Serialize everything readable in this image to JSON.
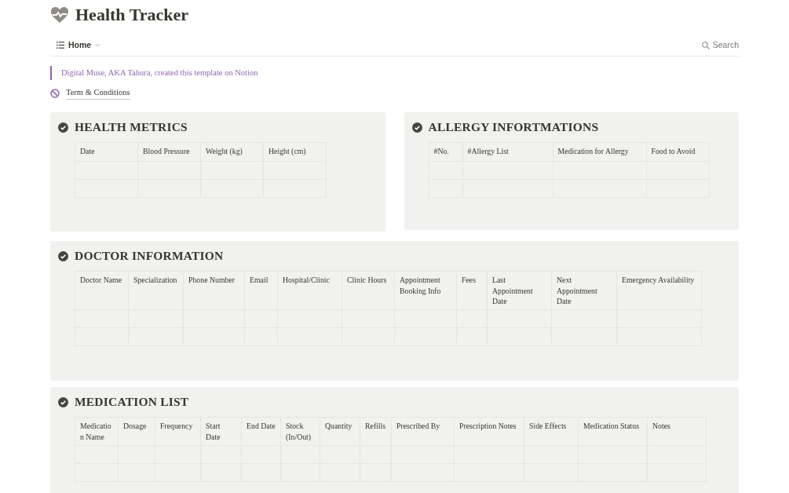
{
  "page": {
    "title": "Health Tracker"
  },
  "nav": {
    "view": "Home",
    "search": "Search"
  },
  "callout": "Digital Muse, AKA Tahura, created this template on Notion",
  "link": "Term & Conditions",
  "sections": [
    {
      "title": "HEALTH METRICS",
      "columns": [
        "Date",
        "Blood Pressure",
        "Weight (kg)",
        "Height (cm)"
      ]
    },
    {
      "title": "ALLERGY INFORTMATIONS",
      "columns": [
        "#No.",
        "#Allergy List",
        "Medication for Allergy",
        "Food to Avoid"
      ]
    },
    {
      "title": "DOCTOR INFORMATION",
      "columns": [
        "Doctor Name",
        "Specialization",
        "Phone Number",
        "Email",
        "Hospital/Clinic",
        "Clinic Hours",
        "Appointment Booking Info",
        "Fees",
        "Last Appointment Date",
        "Next Appointment Date",
        "Emergency Availability"
      ]
    },
    {
      "title": "MEDICATION LIST",
      "columns": [
        "Medication Name",
        "Dosage",
        "Frequency",
        "Start Date",
        "End Date",
        "Stock (In/Out)",
        "Quantity",
        "Refills",
        "Prescribed By",
        "Prescription Notes",
        "Side Effects",
        "Medication Status",
        "Notes"
      ]
    }
  ]
}
